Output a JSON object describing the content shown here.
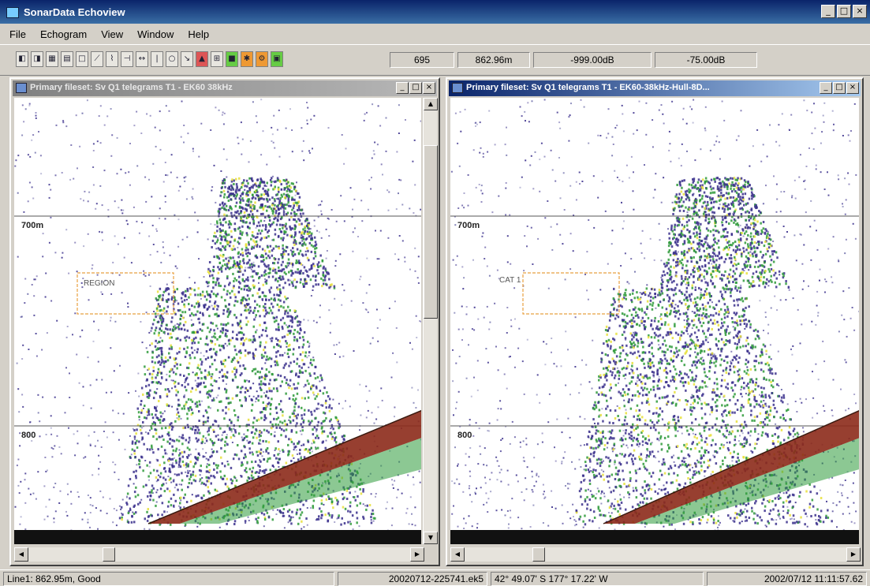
{
  "app": {
    "title": "SonarData Echoview"
  },
  "window_controls": {
    "minimize": "_",
    "maximize": "□",
    "close": "×"
  },
  "menu": [
    "File",
    "Echogram",
    "View",
    "Window",
    "Help"
  ],
  "toolbar": {
    "fields": [
      "695",
      "862.96m",
      "-999.00dB",
      "-75.00dB"
    ]
  },
  "echograms": [
    {
      "title": "Primary fileset: Sv Q1 telegrams T1 - EK60 38kHz",
      "active": false,
      "depth_labels": [
        "700m",
        "800"
      ],
      "region_label": "REGION"
    },
    {
      "title": "Primary fileset: Sv Q1 telegrams T1 - EK60-38kHz-Hull-8D...",
      "active": true,
      "depth_labels": [
        "700m",
        "800"
      ],
      "region_label": "CAT 1"
    }
  ],
  "status": {
    "line": "Line1: 862.95m, Good",
    "file": "20020712-225741.ek5",
    "position": "42° 49.07' S 177° 17.22' W",
    "datetime": "2002/07/12 11:11:57.62"
  },
  "colors": {
    "title_active": "#0a246a",
    "title_inactive": "#808080",
    "echo_low": "#3a2f8c",
    "echo_mid": "#2e9a3a",
    "echo_high": "#e8e03a",
    "echo_seabed": "#8c2a1a"
  }
}
